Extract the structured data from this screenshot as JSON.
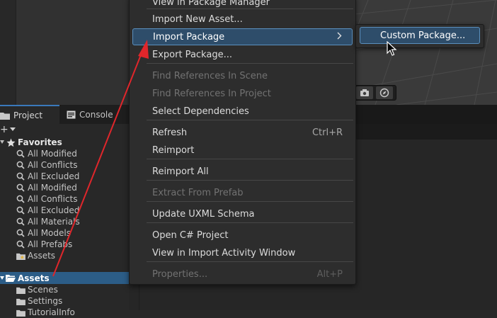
{
  "context_menu": {
    "items": [
      {
        "label": "View in Package Manager",
        "shortcut": "",
        "state": "normal"
      },
      {
        "label": "Import New Asset...",
        "shortcut": "",
        "state": "normal"
      },
      {
        "label": "Import Package",
        "shortcut": "",
        "state": "highlighted",
        "has_submenu": true
      },
      {
        "label": "Export Package...",
        "shortcut": "",
        "state": "normal"
      },
      {
        "label": "Find References In Scene",
        "shortcut": "",
        "state": "disabled"
      },
      {
        "label": "Find References In Project",
        "shortcut": "",
        "state": "disabled"
      },
      {
        "label": "Select Dependencies",
        "shortcut": "",
        "state": "normal"
      },
      {
        "label": "Refresh",
        "shortcut": "Ctrl+R",
        "state": "normal"
      },
      {
        "label": "Reimport",
        "shortcut": "",
        "state": "normal"
      },
      {
        "label": "Reimport All",
        "shortcut": "",
        "state": "normal"
      },
      {
        "label": "Extract From Prefab",
        "shortcut": "",
        "state": "disabled"
      },
      {
        "label": "Update UXML Schema",
        "shortcut": "",
        "state": "normal"
      },
      {
        "label": "Open C# Project",
        "shortcut": "",
        "state": "normal"
      },
      {
        "label": "View in Import Activity Window",
        "shortcut": "",
        "state": "normal"
      },
      {
        "label": "Properties...",
        "shortcut": "Alt+P",
        "state": "disabled"
      }
    ]
  },
  "submenu": {
    "item": "Custom Package..."
  },
  "tabs": {
    "project": "Project",
    "console": "Console"
  },
  "add_button": "+",
  "tree": {
    "favorites_label": "Favorites",
    "favorites": [
      "All Modified",
      "All Conflicts",
      "All Excluded",
      "All Modified",
      "All Conflicts",
      "All Excluded",
      "All Materials",
      "All Models",
      "All Prefabs",
      "Assets"
    ],
    "assets_label": "Assets",
    "assets_children": [
      "Scenes",
      "Settings",
      "TutorialInfo"
    ]
  },
  "colors": {
    "highlight": "#2e4d6a",
    "highlight_border": "#5a8fbd",
    "selected_row": "#2c5d87",
    "annotation_arrow": "#e0262b"
  },
  "icons": {
    "project_tab": "folder-icon",
    "console_tab": "console-icon",
    "favorites": "star-icon",
    "search": "search-icon",
    "folder": "folder-icon",
    "chevron": "chevron-right-icon"
  }
}
